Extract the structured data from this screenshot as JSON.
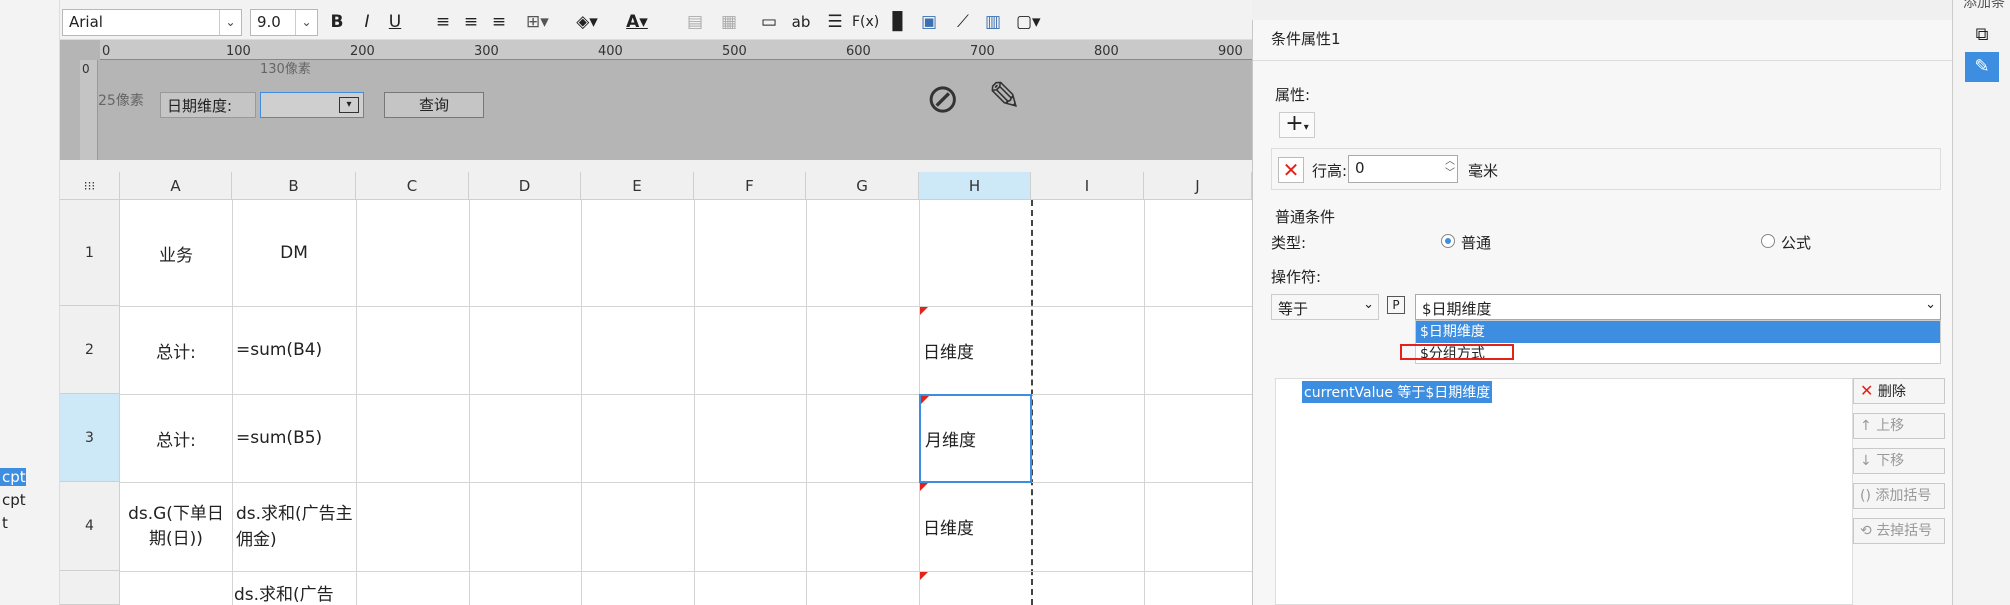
{
  "left_strip": {
    "items": [
      "cpt",
      "cpt",
      "t"
    ]
  },
  "toolbar": {
    "font": "Arial",
    "size": "9.0",
    "bold": "B",
    "italic": "I",
    "underline": "U",
    "text_btn": "ab",
    "formula_btn": "F(x)"
  },
  "form": {
    "ruler_ticks": [
      "0",
      "100",
      "200",
      "300",
      "400",
      "500",
      "600",
      "700",
      "800",
      "900"
    ],
    "vruler_tick": "0",
    "width_hint": "130像素",
    "height_hint": "25像素",
    "date_label": "日期维度:",
    "query_button": "查询"
  },
  "grid": {
    "columns": [
      "A",
      "B",
      "C",
      "D",
      "E",
      "F",
      "G",
      "H",
      "I",
      "J"
    ],
    "rows": [
      "1",
      "2",
      "3",
      "4"
    ],
    "cells": {
      "a1": "业务",
      "b1": "DM",
      "a2": "总计:",
      "b2": "=sum(B4)",
      "h2": "日维度",
      "a3": "总计:",
      "b3": "=sum(B5)",
      "h3": "月维度",
      "a4": "ds.G(下单日期(日))",
      "b4": "ds.求和(广告主佣金)",
      "h4": "日维度",
      "b5": "ds.求和(广告"
    }
  },
  "panel": {
    "title": "条件属性1",
    "attr_label": "属性:",
    "add_btn": "+",
    "row_height_label": "行高:",
    "row_height_value": "0",
    "unit": "毫米",
    "normal_condition": "普通条件",
    "type_label": "类型:",
    "type_normal": "普通",
    "type_formula": "公式",
    "operator_label": "操作符:",
    "operator_value": "等于",
    "param_btn": "P",
    "value_input": "$日期维度",
    "dropdown_options": [
      "$日期维度",
      "$分组方式"
    ],
    "condition_text": "currentValue 等于$日期维度",
    "btn_delete": "删除",
    "btn_up": "上移",
    "btn_down": "下移",
    "btn_add_paren": "添加括号",
    "btn_remove_paren": "去掉括号"
  },
  "right_strip": {
    "title": "添加条"
  },
  "colors": {
    "accent": "#3d8ee0",
    "selected_row": "#cde8f6",
    "red": "#e2231a"
  }
}
